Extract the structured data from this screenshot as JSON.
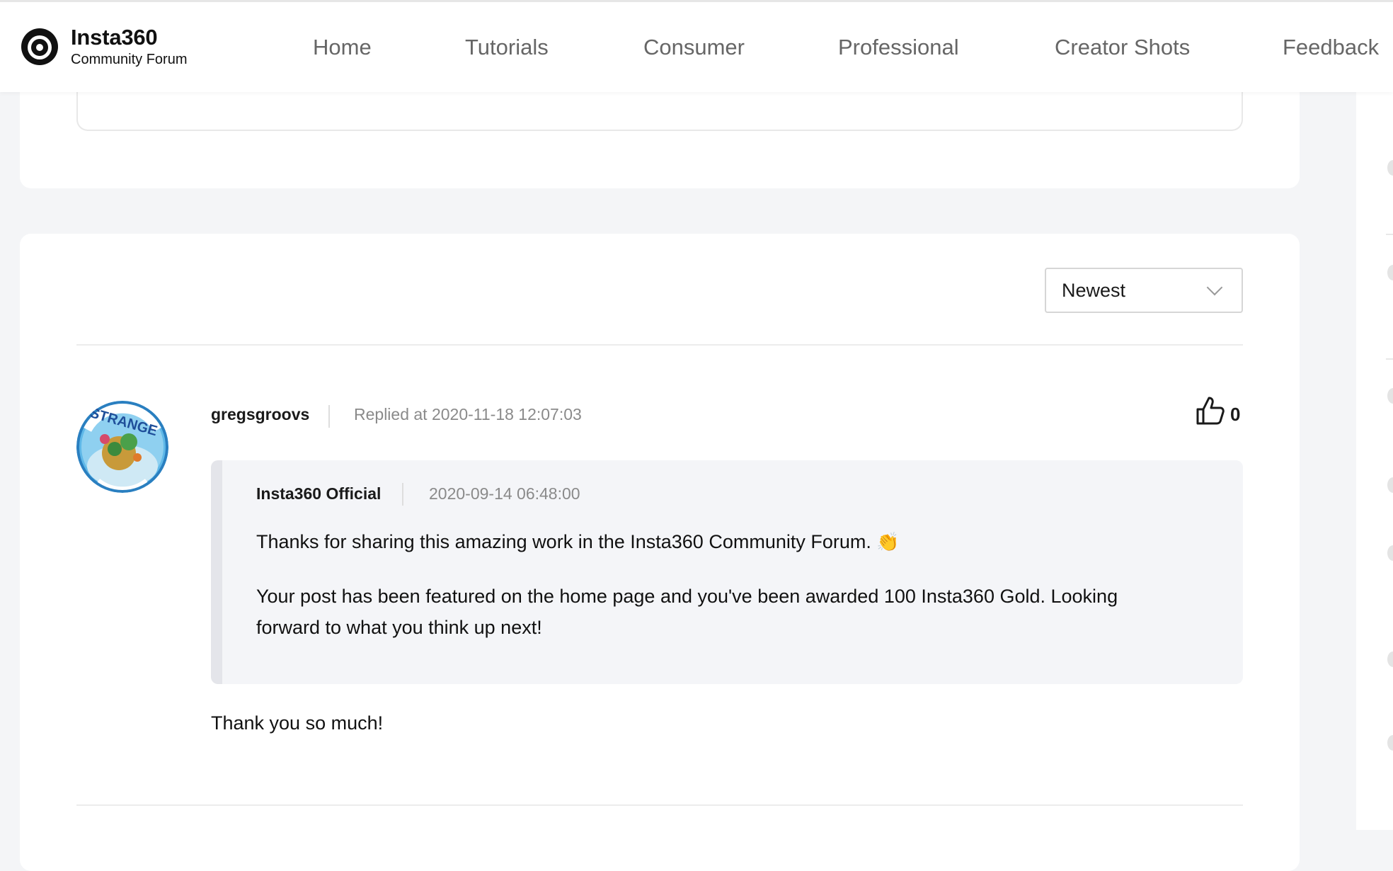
{
  "header": {
    "brand": "Insta360",
    "subtitle": "Community Forum",
    "nav": [
      {
        "label": "Home"
      },
      {
        "label": "Tutorials"
      },
      {
        "label": "Consumer"
      },
      {
        "label": "Professional"
      },
      {
        "label": "Creator Shots"
      },
      {
        "label": "Feedback"
      }
    ]
  },
  "replies": {
    "sort": {
      "selected": "Newest"
    },
    "items": [
      {
        "author": "gregsgroovs",
        "time": "Replied at 2020-11-18 12:07:03",
        "likes": "0",
        "avatar_text": "STRANGE",
        "quote": {
          "author": "Insta360 Official",
          "time": "2020-09-14 06:48:00",
          "p1": "Thanks for sharing this amazing work in the Insta360 Community Forum.",
          "emoji": "👏",
          "p2": "Your post has been featured on the home page and you've been awarded 100 Insta360 Gold. Looking forward to what you think up next!"
        },
        "body": "Thank you so much!"
      }
    ]
  },
  "colors": {
    "page_bg": "#f4f5f7",
    "card_bg": "#ffffff",
    "nav_text": "#666666",
    "muted_text": "#8a8a8a",
    "quote_bg": "#f4f5f8"
  },
  "icons": {
    "logo": "insta360-logo-icon",
    "like": "thumbs-up-icon",
    "sort": "chevron-down-icon"
  }
}
